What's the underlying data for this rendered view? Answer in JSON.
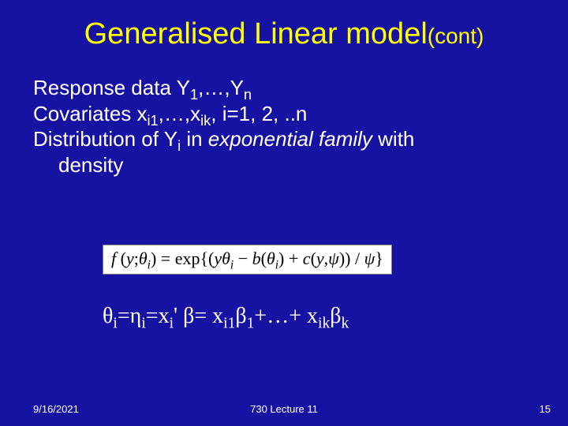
{
  "title": {
    "main": "Generalised Linear model",
    "cont": "(cont)"
  },
  "body": {
    "line1_a": "Response data Y",
    "line1_b": ",…,Y",
    "sub1": "1",
    "subn": "n",
    "line2_a": "Covariates x",
    "line2_b": ",…,x",
    "line2_c": ", i=1, 2, ..n",
    "subi1": "i1",
    "subik": "ik",
    "line3_a": "Distribution of Y",
    "subi": "i",
    "line3_b": " in ",
    "line3_em": "exponential family",
    "line3_c": " with",
    "line4": "density"
  },
  "equation": {
    "f": "f ",
    "open": "(",
    "y": "y",
    "semi": ";",
    "theta": "θ",
    "i": "i",
    "close": ")",
    "eq": " = ",
    "exp": "exp",
    "lbrace": "{",
    "lpar": "(",
    "ytheta": "yθ",
    "minus": " − ",
    "b": "b",
    "plus": " + ",
    "c": "c",
    "comma": ",",
    "psi": "ψ",
    "rpar": ")",
    "slash": " / ",
    "rbrace": "}"
  },
  "thetaline": {
    "theta": "θ",
    "i": "i",
    "eq": "=",
    "eta": "η",
    "x": "x",
    "prime": "'",
    "beta": "β",
    "sp": " ",
    "plus_ell": "+…+ ",
    "one": "1",
    "k": "k",
    "xi1": "i1",
    "xik": "ik",
    "eq2": "= "
  },
  "footer": {
    "left": "9/16/2021",
    "center": "730 Lecture 11",
    "right": "15"
  }
}
